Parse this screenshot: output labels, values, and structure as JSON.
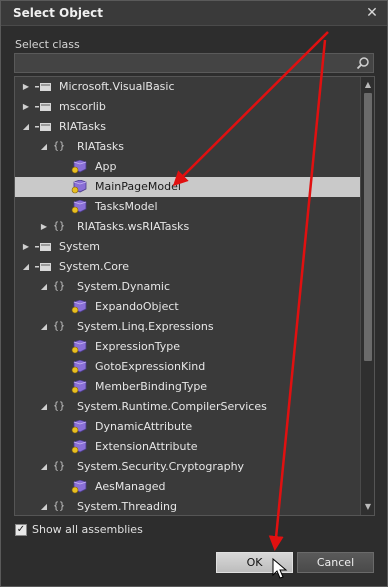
{
  "dialog": {
    "title": "Select Object",
    "close_glyph": "✕",
    "select_class_label": "Select class",
    "search": {
      "value": "",
      "placeholder": ""
    },
    "show_all_assemblies": {
      "label": "Show all assemblies",
      "checked": true
    },
    "ok_label": "OK",
    "cancel_label": "Cancel"
  },
  "tree": {
    "rows": [
      {
        "label": "Microsoft.VisualBasic",
        "kind": "assembly",
        "level": 0,
        "expanded": false
      },
      {
        "label": "mscorlib",
        "kind": "assembly",
        "level": 0,
        "expanded": false
      },
      {
        "label": "RIATasks",
        "kind": "assembly",
        "level": 0,
        "expanded": true
      },
      {
        "label": "RIATasks",
        "kind": "namespace",
        "level": 1,
        "expanded": true
      },
      {
        "label": "App",
        "kind": "class",
        "level": 2
      },
      {
        "label": "MainPageModel",
        "kind": "class",
        "level": 2,
        "selected": true
      },
      {
        "label": "TasksModel",
        "kind": "class",
        "level": 2
      },
      {
        "label": "RIATasks.wsRIATasks",
        "kind": "namespace",
        "level": 1,
        "expanded": false
      },
      {
        "label": "System",
        "kind": "assembly",
        "level": 0,
        "expanded": false
      },
      {
        "label": "System.Core",
        "kind": "assembly",
        "level": 0,
        "expanded": true
      },
      {
        "label": "System.Dynamic",
        "kind": "namespace",
        "level": 1,
        "expanded": true
      },
      {
        "label": "ExpandoObject",
        "kind": "class",
        "level": 2
      },
      {
        "label": "System.Linq.Expressions",
        "kind": "namespace",
        "level": 1,
        "expanded": true
      },
      {
        "label": "ExpressionType",
        "kind": "class",
        "level": 2
      },
      {
        "label": "GotoExpressionKind",
        "kind": "class",
        "level": 2
      },
      {
        "label": "MemberBindingType",
        "kind": "class",
        "level": 2
      },
      {
        "label": "System.Runtime.CompilerServices",
        "kind": "namespace",
        "level": 1,
        "expanded": true
      },
      {
        "label": "DynamicAttribute",
        "kind": "class",
        "level": 2
      },
      {
        "label": "ExtensionAttribute",
        "kind": "class",
        "level": 2
      },
      {
        "label": "System.Security.Cryptography",
        "kind": "namespace",
        "level": 1,
        "expanded": true
      },
      {
        "label": "AesManaged",
        "kind": "class",
        "level": 2
      },
      {
        "label": "System.Threading",
        "kind": "namespace",
        "level": 1,
        "expanded": true
      }
    ]
  },
  "icons": {
    "assembly": "assembly-icon",
    "namespace": "namespace-icon",
    "class": "class-icon",
    "search": "search-icon",
    "close": "close-icon",
    "expanded": "expanded-arrow-icon",
    "collapsed": "collapsed-arrow-icon"
  },
  "colors": {
    "dialog_bg": "#2d2d2d",
    "tree_bg": "#3a3a3a",
    "selection": "#c9c9c9",
    "annotation_arrow": "#e01010",
    "class_icon_primary": "#8a6fd6",
    "class_icon_accent": "#e8c020"
  }
}
